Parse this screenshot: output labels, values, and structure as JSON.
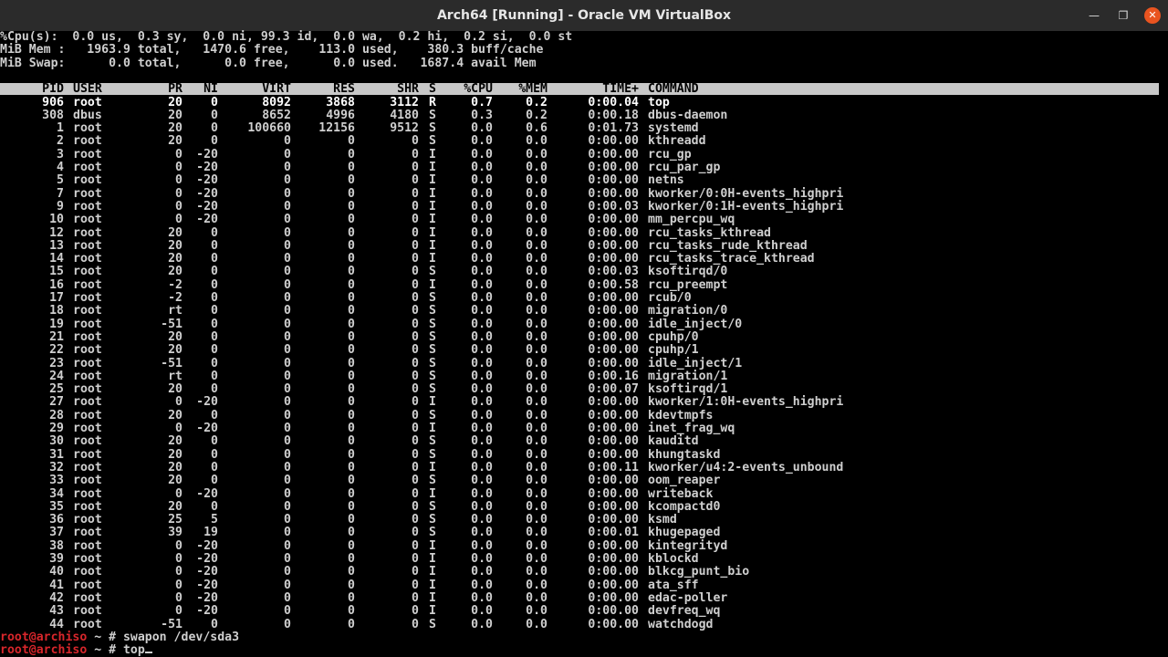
{
  "window": {
    "title": "Arch64 [Running] - Oracle VM VirtualBox",
    "minimize_glyph": "—",
    "maximize_glyph": "❐",
    "close_glyph": "✕"
  },
  "summary": {
    "cpu": "%Cpu(s):  0.0 us,  0.3 sy,  0.0 ni, 99.3 id,  0.0 wa,  0.2 hi,  0.2 si,  0.0 st",
    "mem": "MiB Mem :   1963.9 total,   1470.6 free,    113.0 used,    380.3 buff/cache",
    "swap": "MiB Swap:      0.0 total,      0.0 free,      0.0 used.   1687.4 avail Mem"
  },
  "columns": [
    "PID",
    "USER",
    "PR",
    "NI",
    "VIRT",
    "RES",
    "SHR",
    "S",
    "%CPU",
    "%MEM",
    "TIME+",
    "COMMAND"
  ],
  "processes": [
    [
      "906",
      "root",
      "20",
      "0",
      "8092",
      "3868",
      "3112",
      "R",
      "0.7",
      "0.2",
      "0:00.04",
      "top"
    ],
    [
      "308",
      "dbus",
      "20",
      "0",
      "8652",
      "4996",
      "4180",
      "S",
      "0.3",
      "0.2",
      "0:00.18",
      "dbus-daemon"
    ],
    [
      "1",
      "root",
      "20",
      "0",
      "100660",
      "12156",
      "9512",
      "S",
      "0.0",
      "0.6",
      "0:01.73",
      "systemd"
    ],
    [
      "2",
      "root",
      "20",
      "0",
      "0",
      "0",
      "0",
      "S",
      "0.0",
      "0.0",
      "0:00.00",
      "kthreadd"
    ],
    [
      "3",
      "root",
      "0",
      "-20",
      "0",
      "0",
      "0",
      "I",
      "0.0",
      "0.0",
      "0:00.00",
      "rcu_gp"
    ],
    [
      "4",
      "root",
      "0",
      "-20",
      "0",
      "0",
      "0",
      "I",
      "0.0",
      "0.0",
      "0:00.00",
      "rcu_par_gp"
    ],
    [
      "5",
      "root",
      "0",
      "-20",
      "0",
      "0",
      "0",
      "I",
      "0.0",
      "0.0",
      "0:00.00",
      "netns"
    ],
    [
      "7",
      "root",
      "0",
      "-20",
      "0",
      "0",
      "0",
      "I",
      "0.0",
      "0.0",
      "0:00.00",
      "kworker/0:0H-events_highpri"
    ],
    [
      "9",
      "root",
      "0",
      "-20",
      "0",
      "0",
      "0",
      "I",
      "0.0",
      "0.0",
      "0:00.03",
      "kworker/0:1H-events_highpri"
    ],
    [
      "10",
      "root",
      "0",
      "-20",
      "0",
      "0",
      "0",
      "I",
      "0.0",
      "0.0",
      "0:00.00",
      "mm_percpu_wq"
    ],
    [
      "12",
      "root",
      "20",
      "0",
      "0",
      "0",
      "0",
      "I",
      "0.0",
      "0.0",
      "0:00.00",
      "rcu_tasks_kthread"
    ],
    [
      "13",
      "root",
      "20",
      "0",
      "0",
      "0",
      "0",
      "I",
      "0.0",
      "0.0",
      "0:00.00",
      "rcu_tasks_rude_kthread"
    ],
    [
      "14",
      "root",
      "20",
      "0",
      "0",
      "0",
      "0",
      "I",
      "0.0",
      "0.0",
      "0:00.00",
      "rcu_tasks_trace_kthread"
    ],
    [
      "15",
      "root",
      "20",
      "0",
      "0",
      "0",
      "0",
      "S",
      "0.0",
      "0.0",
      "0:00.03",
      "ksoftirqd/0"
    ],
    [
      "16",
      "root",
      "-2",
      "0",
      "0",
      "0",
      "0",
      "I",
      "0.0",
      "0.0",
      "0:00.58",
      "rcu_preempt"
    ],
    [
      "17",
      "root",
      "-2",
      "0",
      "0",
      "0",
      "0",
      "S",
      "0.0",
      "0.0",
      "0:00.00",
      "rcub/0"
    ],
    [
      "18",
      "root",
      "rt",
      "0",
      "0",
      "0",
      "0",
      "S",
      "0.0",
      "0.0",
      "0:00.00",
      "migration/0"
    ],
    [
      "19",
      "root",
      "-51",
      "0",
      "0",
      "0",
      "0",
      "S",
      "0.0",
      "0.0",
      "0:00.00",
      "idle_inject/0"
    ],
    [
      "21",
      "root",
      "20",
      "0",
      "0",
      "0",
      "0",
      "S",
      "0.0",
      "0.0",
      "0:00.00",
      "cpuhp/0"
    ],
    [
      "22",
      "root",
      "20",
      "0",
      "0",
      "0",
      "0",
      "S",
      "0.0",
      "0.0",
      "0:00.00",
      "cpuhp/1"
    ],
    [
      "23",
      "root",
      "-51",
      "0",
      "0",
      "0",
      "0",
      "S",
      "0.0",
      "0.0",
      "0:00.00",
      "idle_inject/1"
    ],
    [
      "24",
      "root",
      "rt",
      "0",
      "0",
      "0",
      "0",
      "S",
      "0.0",
      "0.0",
      "0:00.16",
      "migration/1"
    ],
    [
      "25",
      "root",
      "20",
      "0",
      "0",
      "0",
      "0",
      "S",
      "0.0",
      "0.0",
      "0:00.07",
      "ksoftirqd/1"
    ],
    [
      "27",
      "root",
      "0",
      "-20",
      "0",
      "0",
      "0",
      "I",
      "0.0",
      "0.0",
      "0:00.00",
      "kworker/1:0H-events_highpri"
    ],
    [
      "28",
      "root",
      "20",
      "0",
      "0",
      "0",
      "0",
      "S",
      "0.0",
      "0.0",
      "0:00.00",
      "kdevtmpfs"
    ],
    [
      "29",
      "root",
      "0",
      "-20",
      "0",
      "0",
      "0",
      "I",
      "0.0",
      "0.0",
      "0:00.00",
      "inet_frag_wq"
    ],
    [
      "30",
      "root",
      "20",
      "0",
      "0",
      "0",
      "0",
      "S",
      "0.0",
      "0.0",
      "0:00.00",
      "kauditd"
    ],
    [
      "31",
      "root",
      "20",
      "0",
      "0",
      "0",
      "0",
      "S",
      "0.0",
      "0.0",
      "0:00.00",
      "khungtaskd"
    ],
    [
      "32",
      "root",
      "20",
      "0",
      "0",
      "0",
      "0",
      "I",
      "0.0",
      "0.0",
      "0:00.11",
      "kworker/u4:2-events_unbound"
    ],
    [
      "33",
      "root",
      "20",
      "0",
      "0",
      "0",
      "0",
      "S",
      "0.0",
      "0.0",
      "0:00.00",
      "oom_reaper"
    ],
    [
      "34",
      "root",
      "0",
      "-20",
      "0",
      "0",
      "0",
      "I",
      "0.0",
      "0.0",
      "0:00.00",
      "writeback"
    ],
    [
      "35",
      "root",
      "20",
      "0",
      "0",
      "0",
      "0",
      "S",
      "0.0",
      "0.0",
      "0:00.00",
      "kcompactd0"
    ],
    [
      "36",
      "root",
      "25",
      "5",
      "0",
      "0",
      "0",
      "S",
      "0.0",
      "0.0",
      "0:00.00",
      "ksmd"
    ],
    [
      "37",
      "root",
      "39",
      "19",
      "0",
      "0",
      "0",
      "S",
      "0.0",
      "0.0",
      "0:00.01",
      "khugepaged"
    ],
    [
      "38",
      "root",
      "0",
      "-20",
      "0",
      "0",
      "0",
      "I",
      "0.0",
      "0.0",
      "0:00.00",
      "kintegrityd"
    ],
    [
      "39",
      "root",
      "0",
      "-20",
      "0",
      "0",
      "0",
      "I",
      "0.0",
      "0.0",
      "0:00.00",
      "kblockd"
    ],
    [
      "40",
      "root",
      "0",
      "-20",
      "0",
      "0",
      "0",
      "I",
      "0.0",
      "0.0",
      "0:00.00",
      "blkcg_punt_bio"
    ],
    [
      "41",
      "root",
      "0",
      "-20",
      "0",
      "0",
      "0",
      "I",
      "0.0",
      "0.0",
      "0:00.00",
      "ata_sff"
    ],
    [
      "42",
      "root",
      "0",
      "-20",
      "0",
      "0",
      "0",
      "I",
      "0.0",
      "0.0",
      "0:00.00",
      "edac-poller"
    ],
    [
      "43",
      "root",
      "0",
      "-20",
      "0",
      "0",
      "0",
      "I",
      "0.0",
      "0.0",
      "0:00.00",
      "devfreq_wq"
    ],
    [
      "44",
      "root",
      "-51",
      "0",
      "0",
      "0",
      "0",
      "S",
      "0.0",
      "0.0",
      "0:00.00",
      "watchdogd"
    ]
  ],
  "shell": {
    "prompt_user": "root@archiso",
    "prompt_rest": " ~ # ",
    "history": [
      {
        "command": "swapon /dev/sda3"
      },
      {
        "command": "top"
      }
    ]
  },
  "colors": {
    "prompt_user": "#d7262b",
    "header_bg": "#c8c8c8",
    "close_button": "#e95420"
  }
}
